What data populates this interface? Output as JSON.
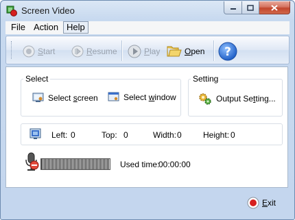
{
  "window": {
    "title": "Screen Video"
  },
  "menu": {
    "file": "File",
    "action": "Action",
    "help": "Help"
  },
  "toolbar": {
    "start": {
      "pre": "",
      "ul": "S",
      "post": "tart"
    },
    "resume": {
      "pre": "",
      "ul": "R",
      "post": "esume"
    },
    "play": {
      "pre": "",
      "ul": "P",
      "post": "lay"
    },
    "open": {
      "pre": "",
      "ul": "O",
      "post": "pen"
    }
  },
  "select_group": {
    "label": "Select",
    "screen": {
      "pre": "Select ",
      "ul": "s",
      "post": "creen"
    },
    "window": {
      "pre": "Select ",
      "ul": "w",
      "post": "indow"
    }
  },
  "setting_group": {
    "label": "Setting",
    "output": {
      "pre": "Output Se",
      "ul": "t",
      "post": "ting..."
    }
  },
  "region": {
    "left": "Left:",
    "left_value": "0",
    "top": "Top:",
    "top_value": "0",
    "width": "Width:",
    "width_value": "0",
    "height": "Height:",
    "height_value": "0"
  },
  "status": {
    "used_time_label": "Used time:",
    "used_time_value": "00:00:00"
  },
  "exit": {
    "pre": "",
    "ul": "E",
    "post": "xit"
  },
  "colors": {
    "accent": "#3a6fc9",
    "close_red": "#c2462d",
    "exit_red": "#d62020"
  }
}
